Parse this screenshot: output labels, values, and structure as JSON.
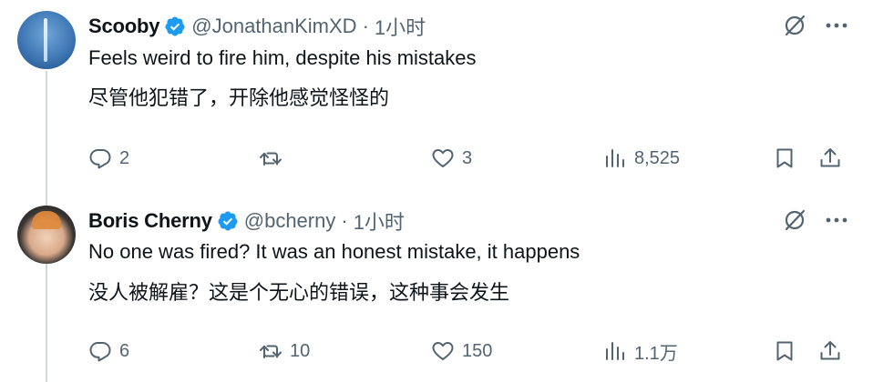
{
  "tweets": [
    {
      "display_name": "Scooby",
      "handle": "@JonathanKimXD",
      "separator": "·",
      "time": "1小时",
      "text_en": "Feels weird to fire him, despite his mistakes",
      "text_zh": "尽管他犯错了，开除他感觉怪怪的",
      "reply_count": "2",
      "retweet_count": "",
      "like_count": "3",
      "view_count": "8,525"
    },
    {
      "display_name": "Boris Cherny",
      "handle": "@bcherny",
      "separator": "·",
      "time": "1小时",
      "text_en": "No one was fired? It was an honest mistake, it happens",
      "text_zh": "没人被解雇？这是个无心的错误，这种事会发生",
      "reply_count": "6",
      "retweet_count": "10",
      "like_count": "150",
      "view_count": "1.1万"
    }
  ],
  "colors": {
    "verified": "#1d9bf0",
    "muted": "#536471",
    "text": "#0f1419",
    "thread_line": "#cfd9de"
  },
  "icons": [
    "verified-badge-icon",
    "grok-icon",
    "more-icon",
    "reply-icon",
    "retweet-icon",
    "like-icon",
    "views-icon",
    "bookmark-icon",
    "share-icon"
  ]
}
